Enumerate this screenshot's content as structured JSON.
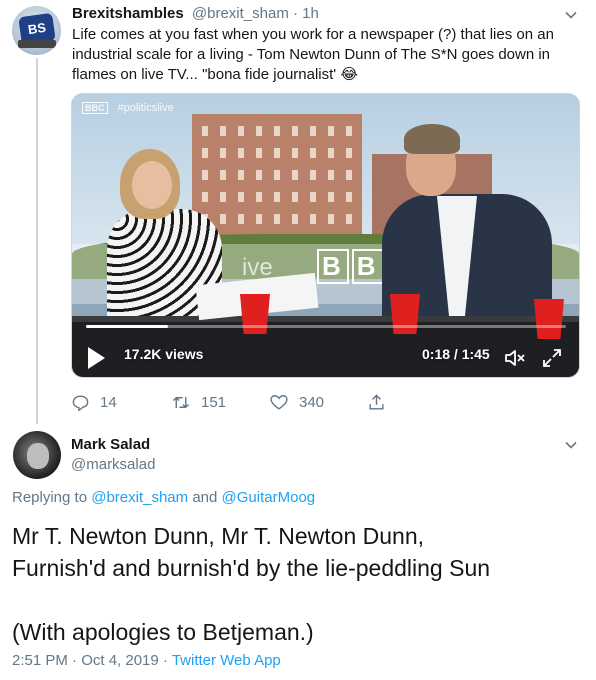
{
  "tweet1": {
    "author_name": "Brexitshambles",
    "handle": "@brexit_sham",
    "separator": " · ",
    "time": "1h",
    "text": "Life comes at you fast when you work for a newspaper (?) that lies on an industrial scale for a living - Tom Newton Dunn of The S*N goes down in flames on live TV... \"bona fide journalist' 😂",
    "video": {
      "hashtag": "#politicslive",
      "channel_badge": "BBC",
      "screen_text": "BBC",
      "screen_text_partial": "ive",
      "views": "17.2K views",
      "time": "0:18 / 1:45",
      "progress_fraction": 0.17
    },
    "actions": {
      "replies": "14",
      "retweets": "151",
      "likes": "340"
    }
  },
  "tweet2": {
    "author_name": "Mark Salad",
    "handle": "@marksalad",
    "replying_prefix": "Replying to ",
    "replying_user1": "@brexit_sham",
    "replying_and": " and ",
    "replying_user2": "@GuitarMoog",
    "body_lines": [
      "Mr T. Newton Dunn, Mr T. Newton Dunn,",
      "Furnish'd and burnish'd by the lie-peddling Sun",
      "",
      "(With apologies to Betjeman.)"
    ],
    "timestamp": "2:51 PM · Oct 4, 2019 · ",
    "client": "Twitter Web App"
  },
  "colors": {
    "accent": "#1da1f2",
    "secondary_text": "#657786",
    "primary_text": "#14171a",
    "thread_line": "#ccd6dd"
  }
}
